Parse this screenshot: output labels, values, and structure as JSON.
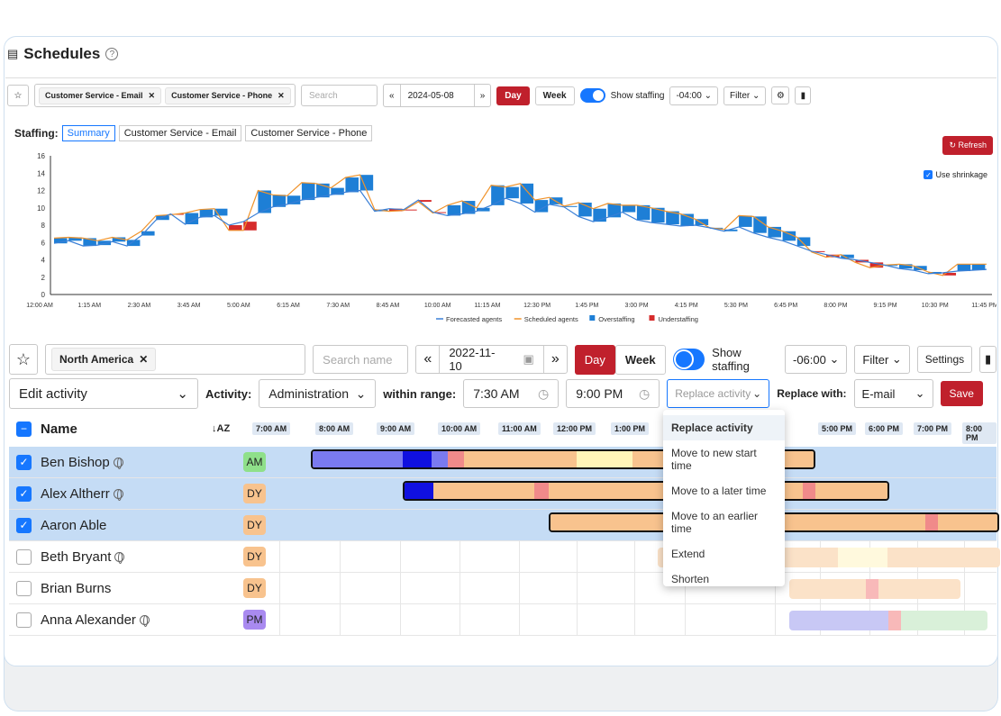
{
  "page": {
    "title": "Schedules"
  },
  "upper": {
    "chips": [
      "Customer Service - Email",
      "Customer Service - Phone"
    ],
    "search_placeholder": "Search",
    "date": "2024-05-08",
    "day_label": "Day",
    "week_label": "Week",
    "show_staffing": "Show staffing",
    "tz": "-04:00",
    "filter": "Filter",
    "staffing_label": "Staffing:",
    "tabs": [
      "Summary",
      "Customer Service - Email",
      "Customer Service - Phone"
    ],
    "refresh": "Refresh",
    "shrinkage": "Use shrinkage"
  },
  "chart_data": {
    "type": "line",
    "x_ticks": [
      "12:00 AM",
      "1:15 AM",
      "2:30 AM",
      "3:45 AM",
      "5:00 AM",
      "6:15 AM",
      "7:30 AM",
      "8:45 AM",
      "10:00 AM",
      "11:15 AM",
      "12:30 PM",
      "1:45 PM",
      "3:00 PM",
      "4:15 PM",
      "5:30 PM",
      "6:45 PM",
      "8:00 PM",
      "9:15 PM",
      "10:30 PM",
      "11:45 PM"
    ],
    "y_ticks": [
      0,
      2,
      4,
      6,
      8,
      10,
      12,
      14,
      16
    ],
    "ylim": [
      0,
      16
    ],
    "legend": [
      "Forecasted agents",
      "Scheduled agents",
      "Overstaffing",
      "Understaffing"
    ],
    "legend_placement": "bottom",
    "colors": {
      "forecast": "#3a7fd6",
      "scheduled": "#f0932b",
      "over": "#1e7fd6",
      "under": "#d62b2b"
    },
    "series": [
      {
        "name": "Forecasted agents",
        "values": [
          5.9,
          6.2,
          5.6,
          5.7,
          6.1,
          5.6,
          6.8,
          8.6,
          9.3,
          8.1,
          8.9,
          9.1,
          8.0,
          8.4,
          9.4,
          10.1,
          10.4,
          10.9,
          11.2,
          11.5,
          11.8,
          12.0,
          9.6,
          9.9,
          9.8,
          10.9,
          9.5,
          9.1,
          9.3,
          9.6,
          10.3,
          11.1,
          10.5,
          9.5,
          10.4,
          10.1,
          9.0,
          8.4,
          8.9,
          9.5,
          8.6,
          8.3,
          8.1,
          7.9,
          8.0,
          7.7,
          7.3,
          7.8,
          7.1,
          6.6,
          6.2,
          5.6,
          5.0,
          4.6,
          4.2,
          4.0,
          3.7,
          3.4,
          3.0,
          2.8,
          2.4,
          2.5,
          2.7,
          2.8,
          2.9
        ]
      },
      {
        "name": "Scheduled agents",
        "values": [
          6.5,
          6.6,
          6.5,
          6.2,
          6.6,
          6.3,
          7.3,
          9.1,
          9.2,
          9.4,
          9.8,
          9.9,
          7.4,
          7.4,
          12.0,
          11.5,
          11.4,
          12.9,
          12.8,
          12.3,
          13.5,
          13.8,
          9.8,
          9.6,
          9.7,
          10.7,
          9.4,
          10.3,
          10.8,
          10.0,
          12.6,
          12.4,
          12.8,
          10.9,
          11.2,
          10.2,
          10.6,
          9.9,
          10.5,
          10.3,
          10.3,
          10.0,
          9.6,
          9.3,
          8.7,
          7.7,
          7.5,
          9.1,
          9.0,
          7.8,
          7.3,
          6.6,
          4.9,
          4.3,
          4.6,
          3.7,
          3.1,
          3.4,
          3.5,
          3.3,
          2.6,
          2.2,
          3.5,
          3.5,
          3.5
        ]
      }
    ]
  },
  "lower": {
    "region_chip": "North America",
    "search_name_placeholder": "Search name",
    "date": "2022-11-10",
    "day_label": "Day",
    "week_label": "Week",
    "show_staffing": "Show staffing",
    "tz": "-06:00",
    "filter": "Filter",
    "settings": "Settings",
    "edit_activity": "Edit activity",
    "activity_label": "Activity:",
    "activity_value": "Administration",
    "within_range": "within range:",
    "start_time": "7:30 AM",
    "end_time": "9:00 PM",
    "replace_activity_placeholder": "Replace activity",
    "replace_with_label": "Replace with:",
    "replace_with_value": "E-mail",
    "save": "Save",
    "name_header": "Name",
    "hours": [
      "7:00 AM",
      "8:00 AM",
      "9:00 AM",
      "10:00 AM",
      "11:00 AM",
      "12:00 PM",
      "1:00 PM",
      "5:00 PM",
      "6:00 PM",
      "7:00 PM",
      "8:00 PM"
    ],
    "rows": [
      {
        "name": "Ben Bishop",
        "shift": "AM",
        "selected": true,
        "shift_color": "#8fe08a",
        "globe": true
      },
      {
        "name": "Alex Altherr",
        "shift": "DY",
        "selected": true,
        "shift_color": "#f8c38e",
        "globe": true
      },
      {
        "name": "Aaron Able",
        "shift": "DY",
        "selected": true,
        "shift_color": "#f8c38e",
        "globe": false
      },
      {
        "name": "Beth Bryant",
        "shift": "DY",
        "selected": false,
        "shift_color": "#f8c38e",
        "globe": true
      },
      {
        "name": "Brian Burns",
        "shift": "DY",
        "selected": false,
        "shift_color": "#f8c38e",
        "globe": false
      },
      {
        "name": "Anna Alexander",
        "shift": "PM",
        "selected": false,
        "shift_color": "#a98af0",
        "globe": true
      }
    ],
    "dropdown": [
      "Replace activity",
      "Move to new start time",
      "Move to a later time",
      "Move to an earlier time",
      "Extend",
      "Shorten"
    ]
  }
}
